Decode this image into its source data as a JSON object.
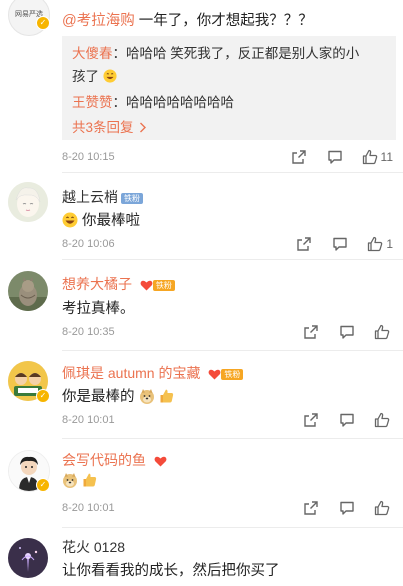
{
  "top_comment": {
    "avatar_caption": "网易严选",
    "text_mention": "@考拉海购",
    "text_rest": " 一年了，你才想起我？？？",
    "replies": [
      {
        "name": "大傻春",
        "text_line1": "：哈哈哈  笑死我了，反正都是别人家的小",
        "text_line2": "孩了"
      },
      {
        "name": "王赞赞",
        "text_line1": "：哈哈哈哈哈哈哈哈"
      }
    ],
    "more_replies": "共3条回复",
    "time": "8-20 10:15",
    "likes": "11"
  },
  "comments": [
    {
      "name": "越上云梢",
      "badge": "铁粉",
      "text": "你最棒啦",
      "time": "8-20 10:06",
      "likes": "1"
    },
    {
      "name": "想养大橘子",
      "badge": "铁粉",
      "text": "考拉真棒。",
      "time": "8-20 10:35",
      "likes": ""
    },
    {
      "name": "佩琪是 autumn 的宝藏",
      "badge": "铁粉",
      "text": "你是最棒的",
      "time": "8-20 10:01",
      "likes": ""
    },
    {
      "name": "会写代码的鱼",
      "badge": "",
      "text": "",
      "time": "8-20 10:01",
      "likes": ""
    },
    {
      "name": "花火 0128",
      "badge": "",
      "text": "让你看看我的成长，然后把你买了",
      "time": "",
      "likes": ""
    }
  ],
  "colors": {
    "accent": "#eb7350",
    "time": "#999999",
    "reply_bg": "#f2f2f2",
    "verified": "#f7b500"
  },
  "icons": [
    "share-icon",
    "comment-icon",
    "like-icon",
    "heart-badge-icon",
    "verified-badge-icon",
    "grin-emoji",
    "doge-emoji",
    "thumbs-up-emoji"
  ]
}
